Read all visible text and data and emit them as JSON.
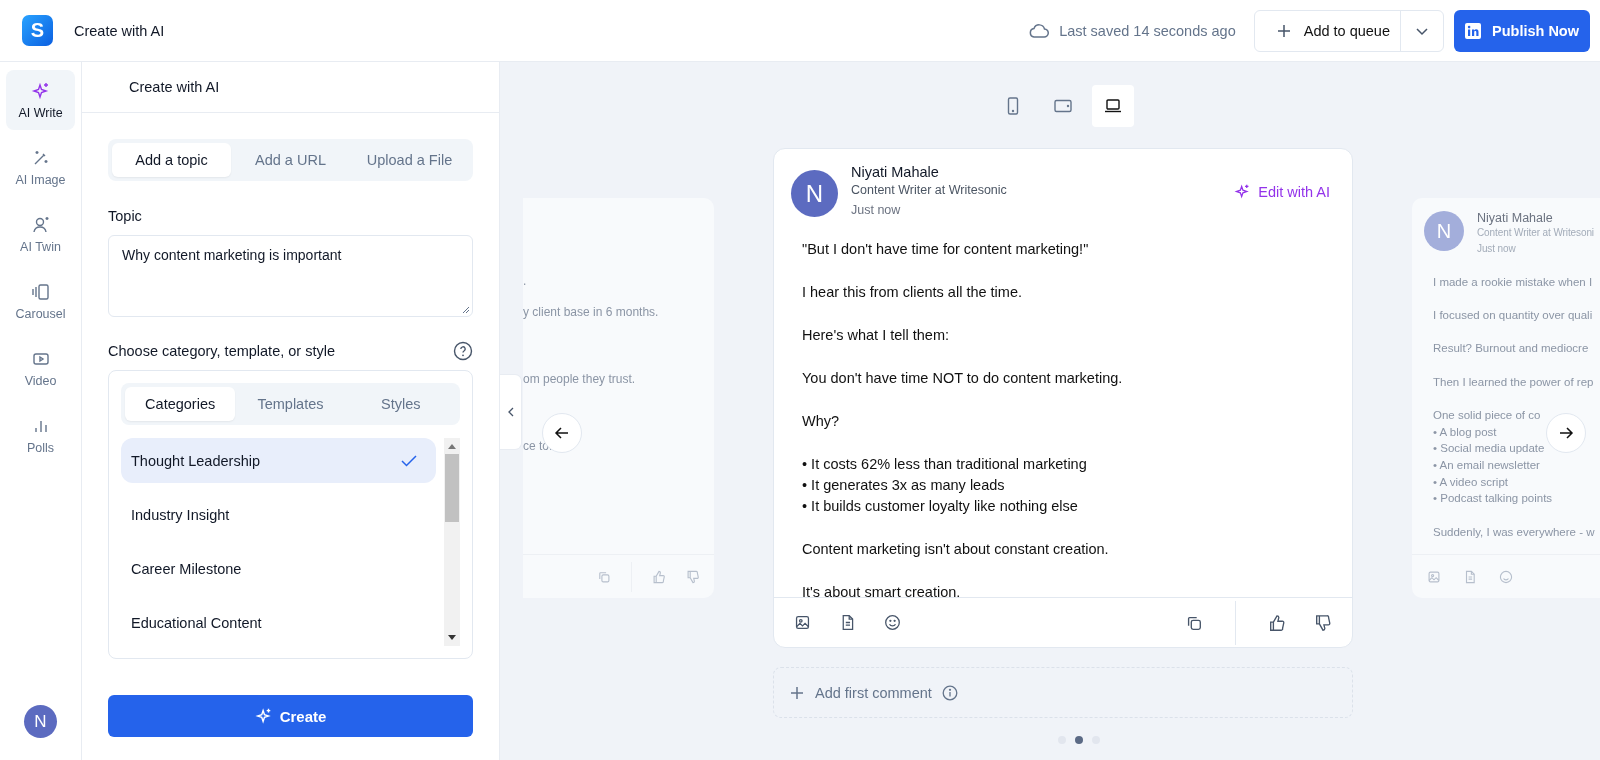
{
  "header": {
    "logo_letter": "S",
    "title": "Create with AI",
    "save_status": "Last saved 14 seconds ago",
    "queue_button": "Add to queue",
    "publish_button": "Publish Now"
  },
  "rail": {
    "items": [
      {
        "kind": "sparkle",
        "label": "AI Write",
        "selected": true
      },
      {
        "kind": "wand",
        "label": "AI Image",
        "selected": false
      },
      {
        "kind": "person",
        "label": "AI Twin",
        "selected": false
      },
      {
        "kind": "carousel",
        "label": "Carousel",
        "selected": false
      },
      {
        "kind": "video",
        "label": "Video",
        "selected": false
      },
      {
        "kind": "chart",
        "label": "Polls",
        "selected": false
      }
    ],
    "avatar": "N"
  },
  "panel": {
    "title": "Create with AI",
    "source_tabs": [
      {
        "label": "Add a topic",
        "selected": true
      },
      {
        "label": "Add a URL",
        "selected": false
      },
      {
        "label": "Upload a File",
        "selected": false
      }
    ],
    "topic_label": "Topic",
    "topic_value": "Why content marketing is important",
    "choose_label": "Choose category, template, or style",
    "style_tabs": [
      {
        "label": "Categories",
        "selected": true
      },
      {
        "label": "Templates",
        "selected": false
      },
      {
        "label": "Styles",
        "selected": false
      }
    ],
    "categories": [
      {
        "label": "Thought Leadership",
        "selected": true
      },
      {
        "label": "Industry Insight",
        "selected": false
      },
      {
        "label": "Career Milestone",
        "selected": false
      },
      {
        "label": "Educational Content",
        "selected": false
      }
    ],
    "create_button": "Create"
  },
  "preview": {
    "devices": [
      {
        "kind": "phone",
        "selected": false
      },
      {
        "kind": "tablet",
        "selected": false
      },
      {
        "kind": "laptop",
        "selected": true
      }
    ],
    "left_card": {
      "lines": [
        ".",
        "y client base in 6 months.",
        "om people they trust.",
        "ce to."
      ]
    },
    "post": {
      "avatar": "N",
      "author": "Niyati Mahale",
      "headline": "Content Writer at Writesonic",
      "time": "Just now",
      "edit_button": "Edit with AI",
      "paragraphs": [
        [
          "\"But I don't have time for content marketing!\""
        ],
        [
          "I hear this from clients all the time."
        ],
        [
          "Here's what I tell them:"
        ],
        [
          "You don't have time NOT to do content marketing."
        ],
        [
          "Why?"
        ],
        [
          "• It costs 62% less than traditional marketing",
          "• It generates 3x as many leads",
          "• It builds customer loyalty like nothing else"
        ],
        [
          "Content marketing isn't about constant creation."
        ],
        [
          "It's about smart creation."
        ]
      ]
    },
    "right_card": {
      "avatar": "N",
      "author": "Niyati Mahale",
      "headline": "Content Writer at Writesoni",
      "time": "Just now",
      "paragraphs": [
        [
          "I made a rookie mistake when I"
        ],
        [
          "I focused on quantity over quali"
        ],
        [
          "Result? Burnout and mediocre"
        ],
        [
          "Then I learned the power of rep"
        ],
        [
          "One solid piece of co",
          "• A blog post",
          "• Social media update",
          "• An email newsletter",
          "• A video script",
          "• Podcast talking points"
        ],
        [
          "Suddenly, I was everywhere - w"
        ]
      ]
    },
    "comment_placeholder": "Add first comment",
    "pages": [
      {
        "selected": false
      },
      {
        "selected": true
      },
      {
        "selected": false
      }
    ]
  }
}
